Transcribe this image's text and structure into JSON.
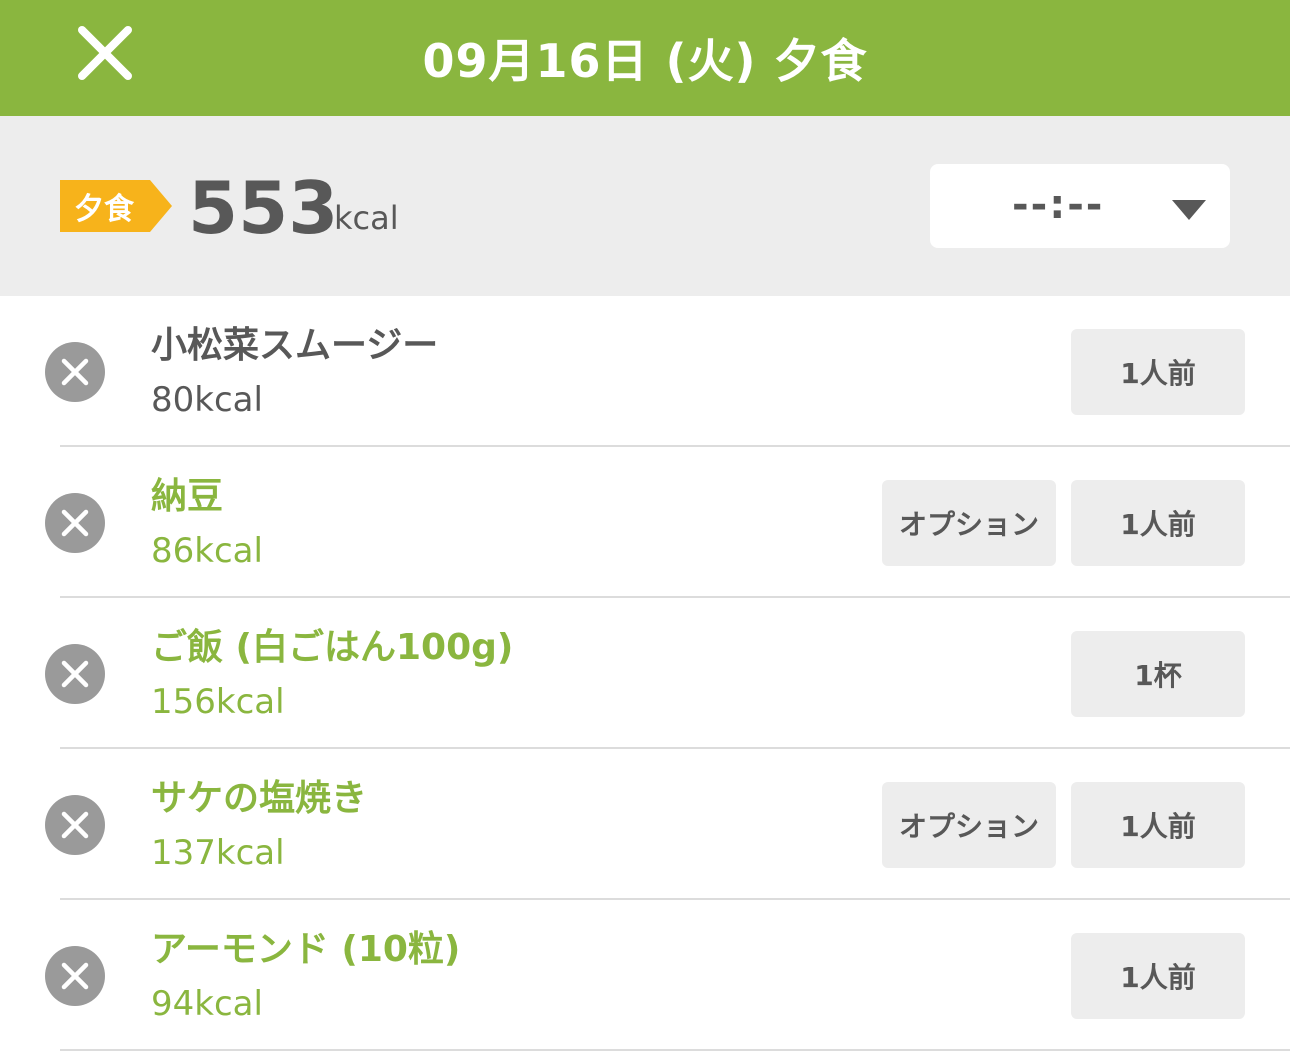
{
  "header": {
    "title": "09月16日 (火) 夕食",
    "close_icon": "close-icon"
  },
  "summary": {
    "meal_label": "夕食",
    "total_kcal": "553",
    "kcal_unit": "kcal",
    "time_value": "--:--",
    "dropdown_icon": "chevron-down-icon"
  },
  "foods": [
    {
      "name": "小松菜スムージー",
      "kcal": "80kcal",
      "portion": "1人前",
      "option": null,
      "linked": false
    },
    {
      "name": "納豆",
      "kcal": "86kcal",
      "portion": "1人前",
      "option": "オプション",
      "linked": true
    },
    {
      "name": "ご飯 (白ごはん100g)",
      "kcal": "156kcal",
      "portion": "1杯",
      "option": null,
      "linked": true
    },
    {
      "name": "サケの塩焼き",
      "kcal": "137kcal",
      "portion": "1人前",
      "option": "オプション",
      "linked": true
    },
    {
      "name": "アーモンド (10粒)",
      "kcal": "94kcal",
      "portion": "1人前",
      "option": null,
      "linked": true
    }
  ],
  "colors": {
    "brand_green": "#8ab63f",
    "badge_orange": "#f7b31b",
    "text_gray": "#585858",
    "panel_gray": "#ededed"
  }
}
